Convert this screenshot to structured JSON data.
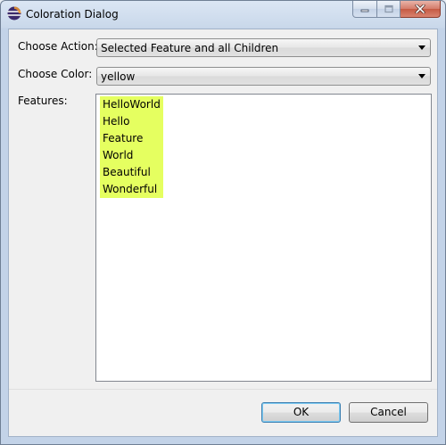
{
  "window": {
    "title": "Coloration Dialog",
    "icon": "eclipse-icon"
  },
  "caption_buttons": {
    "minimize": "minimize-icon",
    "maximize": "maximize-icon",
    "close": "close-icon"
  },
  "form": {
    "action_label": "Choose Action:",
    "action_value": "Selected Feature and all Children",
    "color_label": "Choose Color:",
    "color_value": "yellow",
    "features_label": "Features:"
  },
  "features": [
    "HelloWorld",
    "Hello",
    "Feature",
    "World",
    "Beautiful",
    "Wonderful"
  ],
  "highlight_color": "#e5ff60",
  "buttons": {
    "ok": "OK",
    "cancel": "Cancel"
  }
}
